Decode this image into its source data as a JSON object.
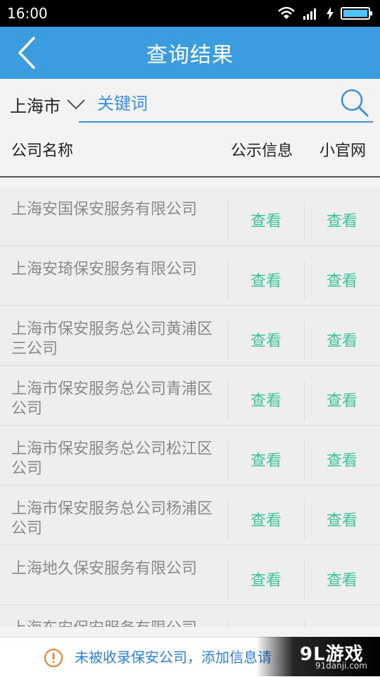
{
  "status_bar": {
    "time": "16:00"
  },
  "app_bar": {
    "title": "查询结果"
  },
  "search": {
    "city": "上海市",
    "placeholder": "关键词"
  },
  "table": {
    "headers": {
      "name": "公司名称",
      "info": "公示信息",
      "site": "小官网"
    },
    "view_label": "查看",
    "rows": [
      {
        "name": "上海安国保安服务有限公司"
      },
      {
        "name": "上海安琦保安服务有限公司"
      },
      {
        "name": "上海市保安服务总公司黄浦区三公司"
      },
      {
        "name": "上海市保安服务总公司青浦区公司"
      },
      {
        "name": "上海市保安服务总公司松江区公司"
      },
      {
        "name": "上海市保安服务总公司杨浦区公司"
      },
      {
        "name": "上海地久保安服务有限公司"
      },
      {
        "name": "上海东安保安服务有限公司"
      }
    ]
  },
  "footer": {
    "text": "未被收录保安公司，添加信息请"
  },
  "watermark": {
    "logo": "9L游戏",
    "url": "91danji.com"
  },
  "colors": {
    "accent": "#3b9ce0",
    "link": "#3cc39a",
    "footer_icon": "#f07a2a"
  }
}
